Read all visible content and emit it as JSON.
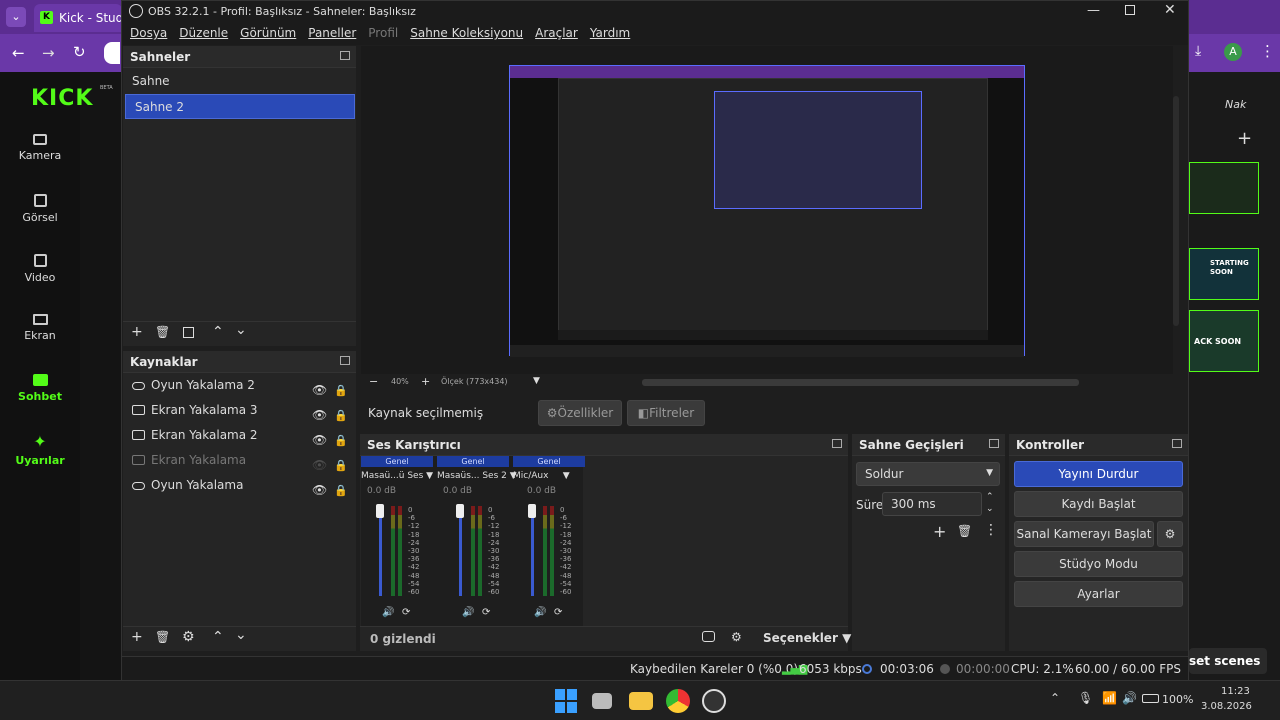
{
  "browser": {
    "tab_title": "Kick - Studio",
    "profile_initial": "A",
    "right_labels": [
      "Nak",
      "STARTING SOON",
      "ACK SOON",
      "set scenes"
    ]
  },
  "kick": {
    "logo": "KICK",
    "beta": "BETA",
    "nav": [
      {
        "label": "Kamera",
        "icon": "camera-icon"
      },
      {
        "label": "Görsel",
        "icon": "image-icon"
      },
      {
        "label": "Video",
        "icon": "video-icon"
      },
      {
        "label": "Ekran",
        "icon": "screen-icon"
      },
      {
        "label": "Sohbet",
        "icon": "chat-icon"
      },
      {
        "label": "Uyarılar",
        "icon": "alerts-icon"
      }
    ],
    "accent": "#53fc18"
  },
  "obs": {
    "title": "OBS 32.2.1 - Profil: Başlıksız - Sahneler: Başlıksız",
    "menu": [
      "Dosya",
      "Düzenle",
      "Görünüm",
      "Paneller",
      "Profil",
      "Sahne Koleksiyonu",
      "Araçlar",
      "Yardım"
    ],
    "scenes": {
      "title": "Sahneler",
      "items": [
        "Sahne",
        "Sahne 2"
      ],
      "selected": "Sahne 2"
    },
    "sources": {
      "title": "Kaynaklar",
      "items": [
        {
          "name": "Oyun Yakalama 2",
          "icon": "gamepad-icon"
        },
        {
          "name": "Ekran Yakalama 3",
          "icon": "monitor-icon"
        },
        {
          "name": "Ekran Yakalama 2",
          "icon": "monitor-icon"
        },
        {
          "name": "Ekran Yakalama",
          "icon": "monitor-icon"
        },
        {
          "name": "Oyun Yakalama",
          "icon": "gamepad-icon"
        }
      ]
    },
    "preview": {
      "zoom": "40%",
      "scale": "Ölçek (773x434)"
    },
    "source_bar": {
      "no_selection": "Kaynak seçilmemiş",
      "properties": "Özellikler",
      "filters": "Filtreler"
    },
    "mixer": {
      "title": "Ses Karıştırıcı",
      "channels": [
        {
          "group": "Genel",
          "name": "Masaü...ü Ses",
          "db": "0.0 dB"
        },
        {
          "group": "Genel",
          "name": "Masaüs... Ses 2",
          "db": "0.0 dB"
        },
        {
          "group": "Genel",
          "name": "Mic/Aux",
          "db": "0.0 dB"
        }
      ],
      "scale": [
        "0",
        "-6",
        "-12",
        "-18",
        "-24",
        "-30",
        "-36",
        "-42",
        "-48",
        "-54",
        "-60"
      ],
      "hidden": "0 gizlendi",
      "options": "Seçenekler"
    },
    "transitions": {
      "title": "Sahne Geçişleri",
      "type": "Soldur",
      "duration_label": "Süre",
      "duration": "300 ms"
    },
    "controls": {
      "title": "Kontroller",
      "stop_stream": "Yayını Durdur",
      "start_recording": "Kaydı Başlat",
      "virtual_cam": "Sanal Kamerayı Başlat",
      "studio_mode": "Stüdyo Modu",
      "settings": "Ayarlar"
    },
    "status": {
      "dropped": "Kaybedilen Kareler 0 (%0.0)",
      "bitrate": "6053 kbps",
      "stream_time": "00:03:06",
      "rec_time": "00:00:00",
      "cpu": "CPU: 2.1%",
      "fps": "60.00 / 60.00 FPS"
    }
  },
  "taskbar": {
    "battery": "100%",
    "time": "11:23",
    "date": "3.08.2026"
  }
}
